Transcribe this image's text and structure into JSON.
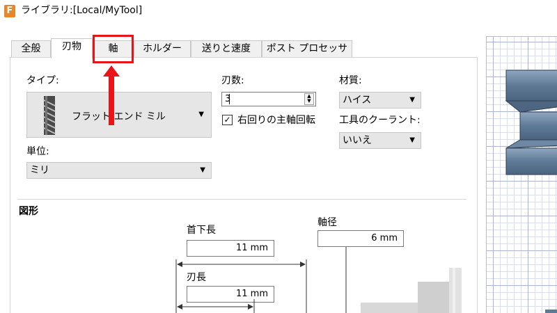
{
  "window": {
    "title": "ライブラリ:[Local/MyTool]",
    "app_icon_letter": "F"
  },
  "tabs": [
    {
      "label": "全般"
    },
    {
      "label": "刃物"
    },
    {
      "label": "軸"
    },
    {
      "label": "ホルダー"
    },
    {
      "label": "送りと速度"
    },
    {
      "label": "ポスト プロセッサ"
    }
  ],
  "type": {
    "label": "タイプ:",
    "value": "フラット エンド ミル"
  },
  "flutes": {
    "label": "刃数:",
    "value": "3"
  },
  "material": {
    "label": "材質:",
    "value": "ハイス"
  },
  "spindle": {
    "label": "右回りの主軸回転",
    "checked": true
  },
  "coolant": {
    "label": "工具のクーラント:",
    "value": "いいえ"
  },
  "unit": {
    "label": "単位:",
    "value": "ミリ"
  },
  "geometry": {
    "section_title": "図形",
    "body_length": {
      "label": "首下長",
      "value": "11 mm"
    },
    "shaft_diameter": {
      "label": "軸径",
      "value": "6 mm"
    },
    "flute_length": {
      "label": "刃長",
      "value": "11 mm"
    }
  },
  "colors": {
    "highlight": "#e8141a",
    "tool_shade": "#6f8aa6",
    "grid_major": "#a9b6d2",
    "grid_minor": "#d7deec"
  }
}
